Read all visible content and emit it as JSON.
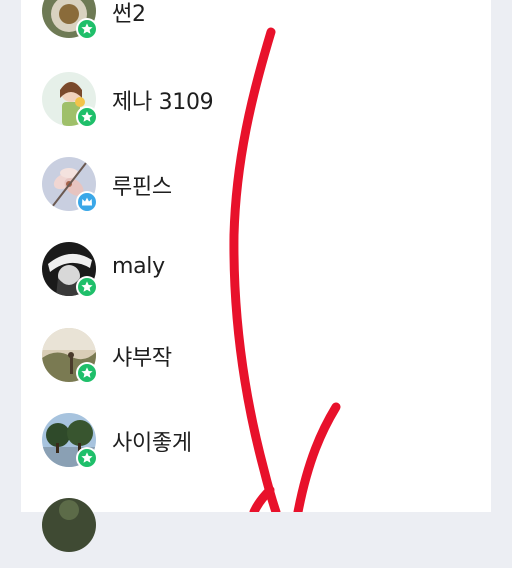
{
  "members": [
    {
      "name": "썬2",
      "badge": "star-badge-icon",
      "badge_color": "#1fbf6a"
    },
    {
      "name": "제나 3109",
      "badge": "star-badge-icon",
      "badge_color": "#1fbf6a"
    },
    {
      "name": "루핀스",
      "badge": "crown-badge-icon",
      "badge_color": "#3aa7e8"
    },
    {
      "name": "maly",
      "badge": "star-badge-icon",
      "badge_color": "#1fbf6a"
    },
    {
      "name": "샤부작",
      "badge": "star-badge-icon",
      "badge_color": "#1fbf6a"
    },
    {
      "name": "사이좋게",
      "badge": "star-badge-icon",
      "badge_color": "#1fbf6a"
    }
  ],
  "annotation": {
    "color": "#e8112b"
  },
  "colors": {
    "background": "#eceef3",
    "panel": "#ffffff"
  }
}
